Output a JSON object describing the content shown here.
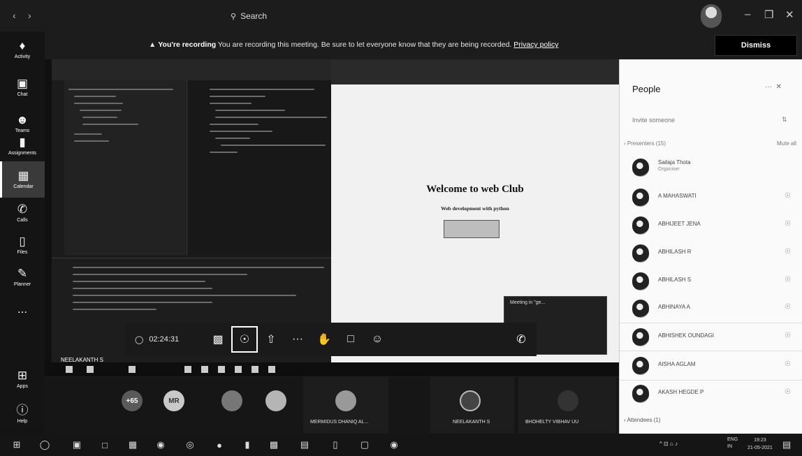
{
  "titlebar": {
    "search_placeholder": "Search",
    "nav_back": "‹",
    "nav_forward": "›",
    "minimize": "–",
    "restore": "❐",
    "close": "✕"
  },
  "banner": {
    "bold": "You're recording",
    "text": "You are recording this meeting. Be sure to let everyone know that they are being recorded.",
    "link": "Privacy policy",
    "dismiss": "Dismiss"
  },
  "appbar": {
    "items": [
      {
        "label": "Activity",
        "icon": "bell-icon"
      },
      {
        "label": "Chat",
        "icon": "chat-icon"
      },
      {
        "label": "Teams",
        "icon": "teams-icon"
      },
      {
        "label": "Assignments",
        "icon": "assignments-icon"
      },
      {
        "label": "Calendar",
        "icon": "calendar-icon"
      },
      {
        "label": "Calls",
        "icon": "phone-icon"
      },
      {
        "label": "Files",
        "icon": "file-icon"
      },
      {
        "label": "Planner",
        "icon": "planner-icon"
      },
      {
        "label": "...",
        "icon": "more-icon"
      },
      {
        "label": "Apps",
        "icon": "apps-icon"
      },
      {
        "label": "Help",
        "icon": "help-icon"
      }
    ]
  },
  "shared": {
    "welcome_title": "Welcome to web Club",
    "welcome_sub": "Web development with python",
    "welcome_btn": "",
    "mini_title": "Meeting in \"ge..."
  },
  "controls": {
    "timer": "02:24:31"
  },
  "presenter_tag": "NEELAKANTH S",
  "strip": {
    "circles": [
      {
        "text": "+65",
        "color": "#5a5a5a"
      },
      {
        "text": "MR",
        "color": "#c9c9c9"
      },
      {
        "text": "",
        "color": "#777"
      },
      {
        "text": "",
        "color": "#b5b5b5"
      }
    ],
    "tiles": [
      {
        "name": "MERMIDUS DHANIQ AL..."
      },
      {
        "name": "NEELAKANTH S"
      },
      {
        "name": "BHOHELTY VIBHAV UU"
      }
    ]
  },
  "people": {
    "title": "People",
    "invite_placeholder": "Invite someone",
    "presenters_label": "Presenters (15)",
    "mute_all": "Mute all",
    "list": [
      {
        "name": "Sailaja Thota",
        "role": "Organiser"
      },
      {
        "name": "A MAHASWATI",
        "role": ""
      },
      {
        "name": "ABHIJEET JENA",
        "role": ""
      },
      {
        "name": "ABHILASH R",
        "role": ""
      },
      {
        "name": "ABHILASH S",
        "role": ""
      },
      {
        "name": "ABHINAYA A",
        "role": ""
      },
      {
        "name": "ABHISHEK OUNDAGI",
        "role": ""
      },
      {
        "name": "AISHA AGLAM",
        "role": ""
      },
      {
        "name": "AKASH HEGDE P",
        "role": ""
      }
    ],
    "attendees_label": "Attendees (1)"
  },
  "taskbar": {
    "tray": "^ ⊡ ⌂ ♪",
    "lang_top": "ENG",
    "lang_bottom": "IN",
    "time": "19:23",
    "date": "21-05-2021"
  }
}
